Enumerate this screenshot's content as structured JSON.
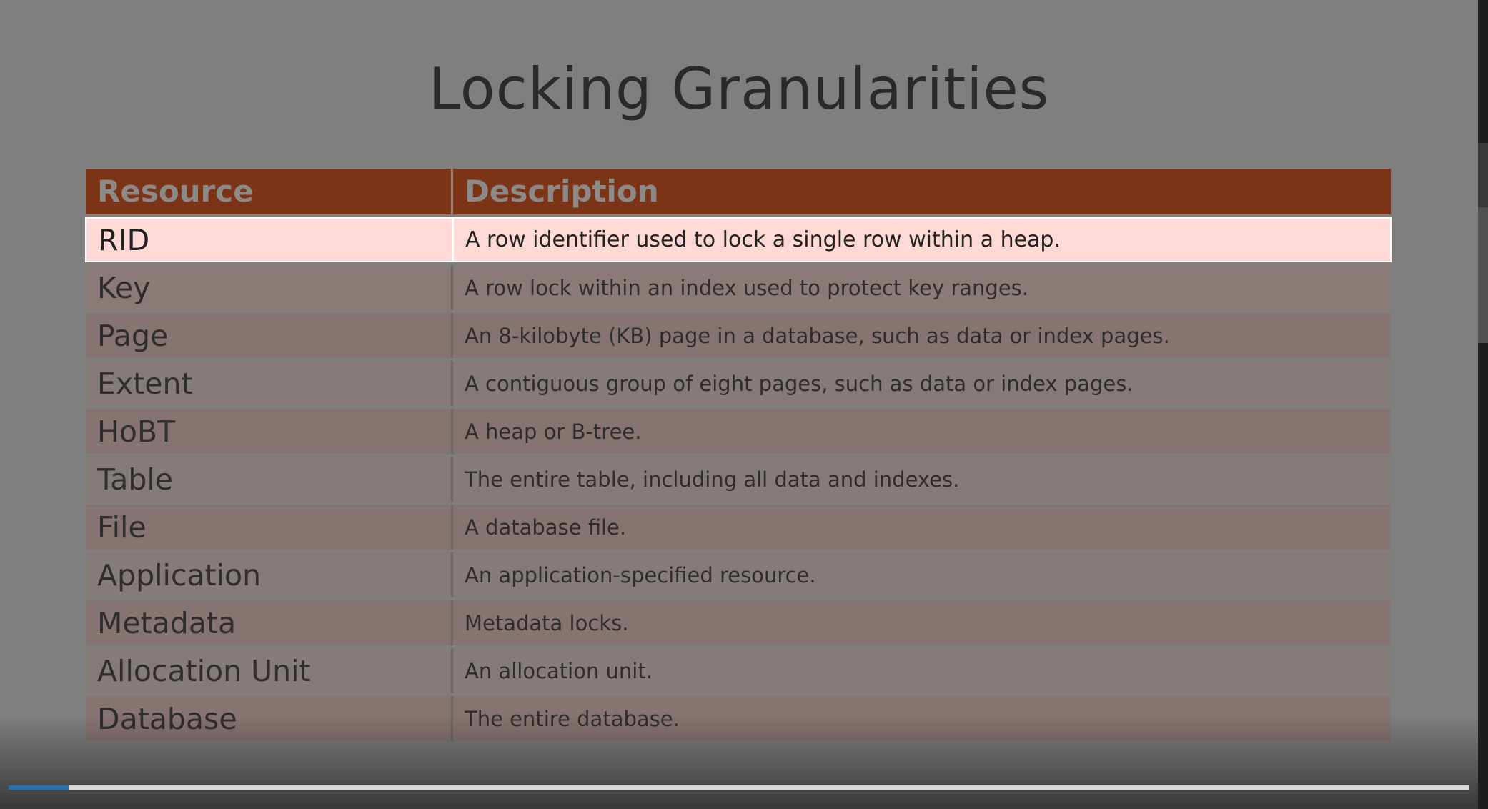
{
  "slide": {
    "title": "Locking Granularities"
  },
  "table": {
    "headers": {
      "resource": "Resource",
      "description": "Description"
    },
    "rows": [
      {
        "resource": "RID",
        "description": "A row identifier used to lock a single row within a heap."
      },
      {
        "resource": "Key",
        "description": "A row lock within an index used to protect key ranges."
      },
      {
        "resource": "Page",
        "description": "An 8-kilobyte (KB) page in a database, such as data or index pages."
      },
      {
        "resource": "Extent",
        "description": "A contiguous group of eight pages, such as data or index pages."
      },
      {
        "resource": "HoBT",
        "description": "A heap or B-tree."
      },
      {
        "resource": "Table",
        "description": "The entire table, including all data and indexes."
      },
      {
        "resource": "File",
        "description": "A database file."
      },
      {
        "resource": "Application",
        "description": "An application-specified resource."
      },
      {
        "resource": "Metadata",
        "description": "Metadata locks."
      },
      {
        "resource": "Allocation Unit",
        "description": "An allocation unit."
      },
      {
        "resource": "Database",
        "description": "The entire database."
      }
    ],
    "highlighted_row": "RID"
  },
  "player": {
    "progress_fraction": 0.041
  },
  "colors": {
    "header_bg": "#7c3416",
    "highlight_bg": "#ffd9d6",
    "progress": "#1d73b8"
  }
}
